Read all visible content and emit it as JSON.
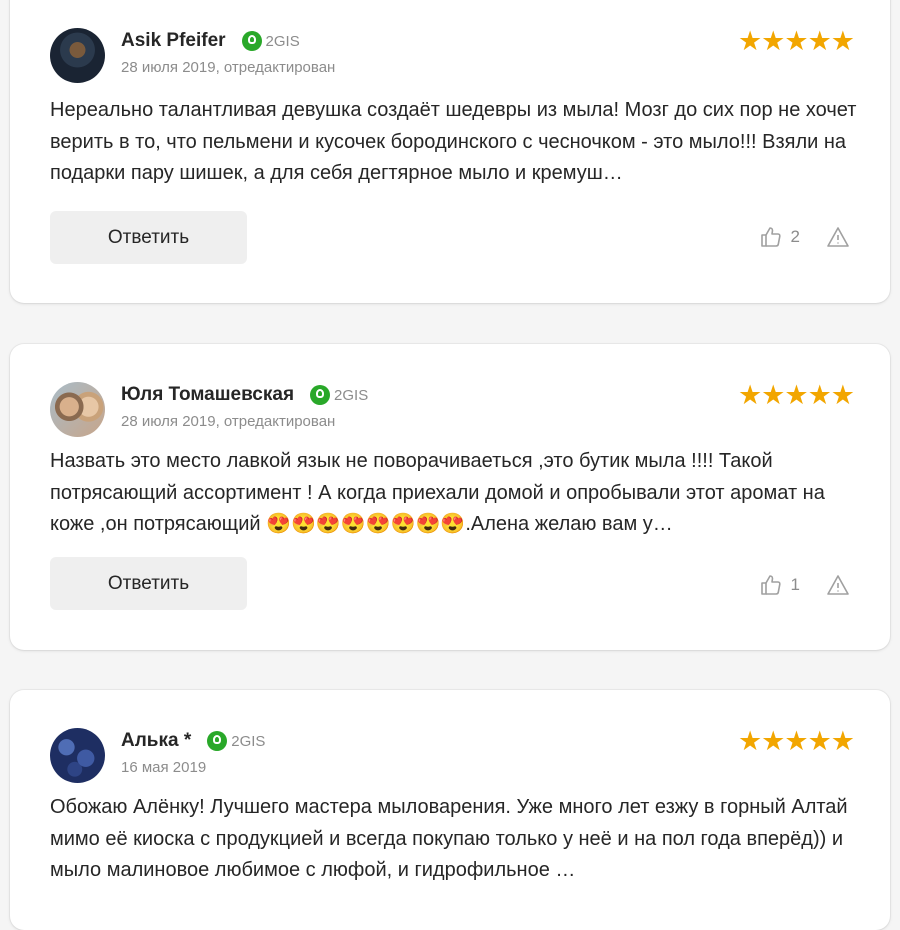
{
  "reviews": [
    {
      "author": "Asik Pfeifer",
      "source": "2GIS",
      "date": "28 июля 2019, отредактирован",
      "rating": "★★★★★",
      "text": "Нереально талантливая девушка создаёт шедевры из мыла! Мозг до сих пор не хочет верить в то, что пельмени и кусочек бородинского с чесночком - это мыло!!! Взяли на подарки пару шишек, а для себя дегтярное мыло и кремуш…",
      "reply_label": "Ответить",
      "likes": "2"
    },
    {
      "author": "Юля Томашевская",
      "source": "2GIS",
      "date": "28 июля 2019, отредактирован",
      "rating": "★★★★★",
      "text": "Назвать это место лавкой язык не поворачиваеться ,это бутик мыла !!!! Такой потрясающий ассортимент ! А когда приехали домой и опробывали этот аромат на коже ,он потрясающий 😍😍😍😍😍😍😍😍.Алена желаю вам у…",
      "reply_label": "Ответить",
      "likes": "1"
    },
    {
      "author": "Алька *",
      "source": "2GIS",
      "date": "16 мая 2019",
      "rating": "★★★★★",
      "text": "Обожаю Алёнку! Лучшего мастера мыловарения. Уже много лет езжу в горный Алтай мимо её киоска с продукцией и всегда покупаю только у неё и на пол года вперёд)) и мыло малиновое любимое с люфой, и гидрофильное …"
    }
  ],
  "colors": {
    "star": "#f2a600",
    "badge": "#29a829",
    "muted": "#8c8c8c"
  },
  "icons": [
    "thumbs-up-icon",
    "warning-icon",
    "2gis-badge-icon"
  ]
}
